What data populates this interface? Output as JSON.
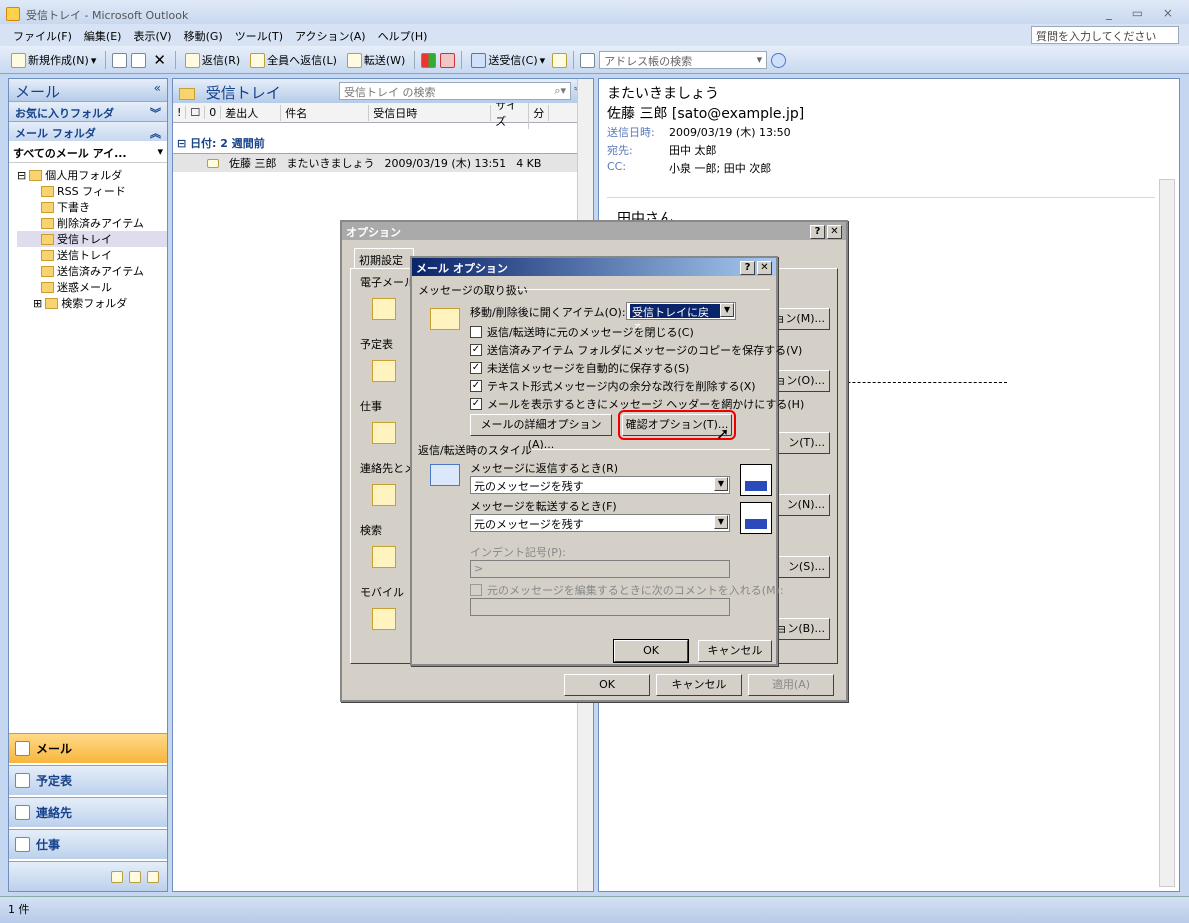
{
  "window": {
    "title": "受信トレイ - Microsoft Outlook",
    "controls": "_ ▭ ×"
  },
  "menu": {
    "items": [
      "ファイル(F)",
      "編集(E)",
      "表示(V)",
      "移動(G)",
      "ツール(T)",
      "アクション(A)",
      "ヘルプ(H)"
    ],
    "help_placeholder": "質問を入力してください"
  },
  "toolbar": {
    "new": "新規作成(N)",
    "reply": "返信(R)",
    "reply_all": "全員へ返信(L)",
    "forward": "転送(W)",
    "send_receive": "送受信(C)",
    "address_search": "アドレス帳の検索"
  },
  "nav": {
    "title": "メール",
    "favorites": "お気に入りフォルダ",
    "mail_folders": "メール フォルダ",
    "all_items": "すべてのメール アイ...",
    "tree": [
      {
        "label": "個人用フォルダ",
        "indent": 0
      },
      {
        "label": "RSS フィード",
        "indent": 1
      },
      {
        "label": "下書き",
        "indent": 1
      },
      {
        "label": "削除済みアイテム",
        "indent": 1
      },
      {
        "label": "受信トレイ",
        "indent": 1,
        "selected": true
      },
      {
        "label": "送信トレイ",
        "indent": 1
      },
      {
        "label": "送信済みアイテム",
        "indent": 1
      },
      {
        "label": "迷惑メール",
        "indent": 1
      },
      {
        "label": "検索フォルダ",
        "indent": 1
      }
    ],
    "buttons": [
      "メール",
      "予定表",
      "連絡先",
      "仕事"
    ]
  },
  "list": {
    "title": "受信トレイ",
    "search_placeholder": "受信トレイ の検索",
    "columns": {
      "from": "差出人",
      "subject": "件名",
      "received": "受信日時",
      "size": "サイズ",
      "flag": "分"
    },
    "group": "日付: 2 週間前",
    "row": {
      "from": "佐藤 三郎",
      "subject": "またいきましょう",
      "received": "2009/03/19 (木) 13:51",
      "size": "4 KB"
    }
  },
  "reading": {
    "subject": "またいきましょう",
    "from": "佐藤 三郎 [sato@example.jp]",
    "sent_label": "送信日時:",
    "sent_value": "2009/03/19 (木) 13:50",
    "to_label": "宛先:",
    "to_value": "田中 太郎",
    "cc_label": "CC:",
    "cc_value": "小泉 一郎; 田中 次郎",
    "body_greeting": "田中さん"
  },
  "options_dialog": {
    "title": "オプション",
    "tab_active": "初期設定",
    "sections": [
      "電子メール",
      "予定表",
      "仕事",
      "連絡先とメ",
      "検索",
      "モバイル"
    ],
    "right_buttons": [
      "ョン(M)...",
      "ョン(O)...",
      "ン(T)...",
      "ン(N)...",
      "ン(S)...",
      "ョン(B)..."
    ],
    "ok": "OK",
    "cancel": "キャンセル",
    "apply": "適用(A)"
  },
  "mail_options": {
    "title": "メール オプション",
    "group1": "メッセージの取り扱い",
    "after_move_label": "移動/削除後に開くアイテム(O):",
    "after_move_value": "受信トレイに戻る",
    "checks": [
      {
        "label": "返信/転送時に元のメッセージを閉じる(C)",
        "checked": false
      },
      {
        "label": "送信済みアイテム フォルダにメッセージのコピーを保存する(V)",
        "checked": true
      },
      {
        "label": "未送信メッセージを自動的に保存する(S)",
        "checked": true
      },
      {
        "label": "テキスト形式メッセージ内の余分な改行を削除する(X)",
        "checked": true
      },
      {
        "label": "メールを表示するときにメッセージ ヘッダーを網かけにする(H)",
        "checked": true
      }
    ],
    "advanced_btn": "メールの詳細オプション(A)...",
    "tracking_btn": "確認オプション(T)...",
    "group2": "返信/転送時のスタイル",
    "reply_label": "メッセージに返信するとき(R)",
    "reply_value": "元のメッセージを残す",
    "forward_label": "メッセージを転送するとき(F)",
    "forward_value": "元のメッセージを残す",
    "indent_label": "インデント記号(P):",
    "indent_value": ">",
    "comment_label": "元のメッセージを編集するときに次のコメントを入れる(M):",
    "ok": "OK",
    "cancel": "キャンセル"
  },
  "status": {
    "count": "1 件"
  }
}
